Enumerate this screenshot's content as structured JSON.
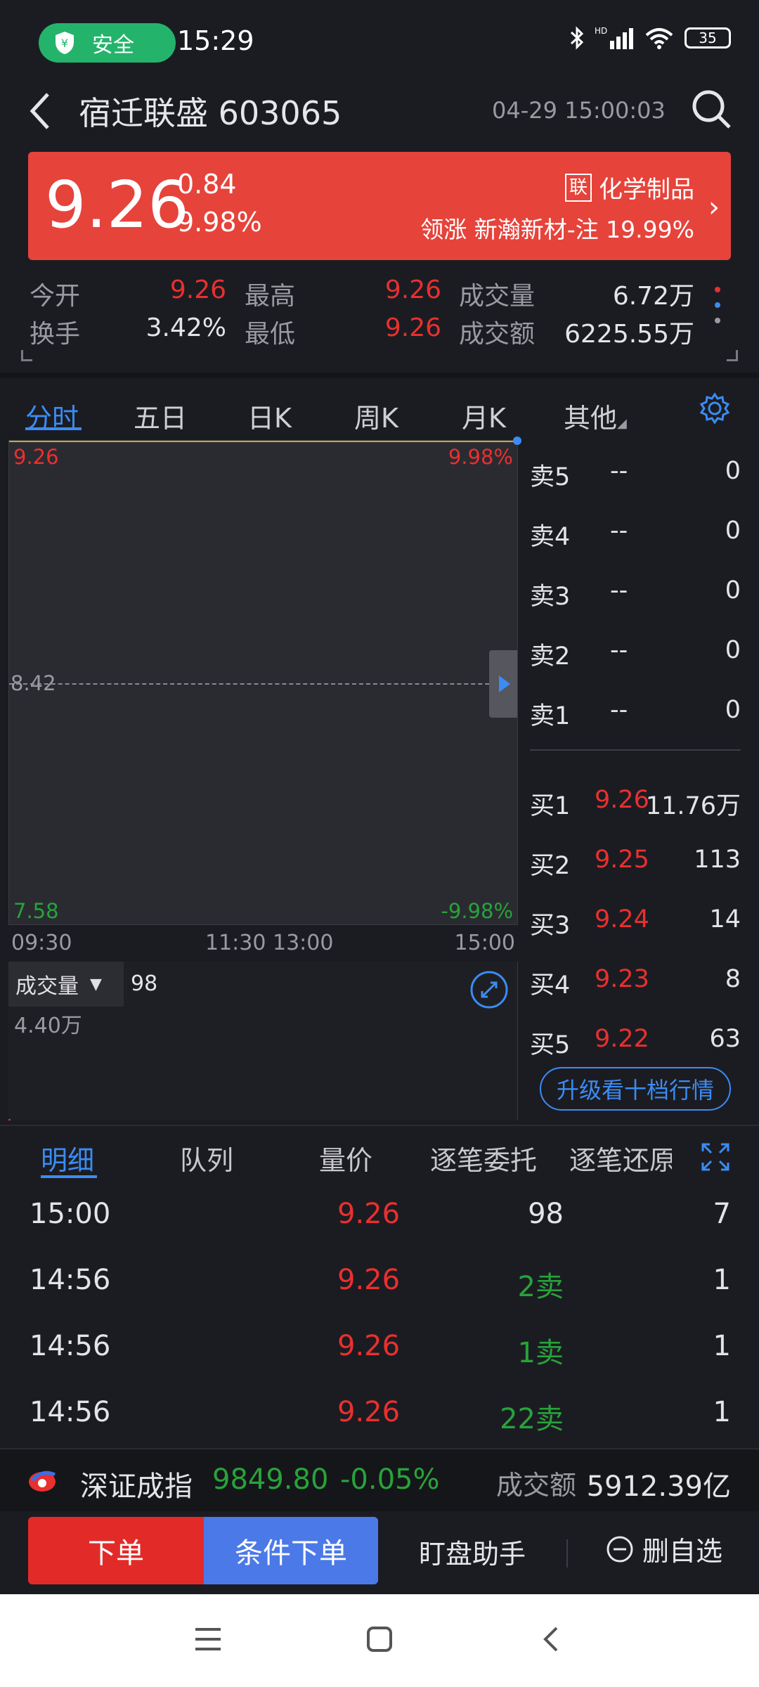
{
  "status": {
    "safe_label": "安全",
    "time": "15:29",
    "battery": "35",
    "hd": "HD"
  },
  "header": {
    "title": "宿迁联盛 603065",
    "timestamp": "04-29 15:00:03"
  },
  "quote": {
    "price": "9.26",
    "change": "0.84",
    "change_pct": "9.98%",
    "sector_tag": "联",
    "sector": "化学制品",
    "leader": "领涨 新瀚新材-注 19.99%"
  },
  "stats": {
    "open_label": "今开",
    "open": "9.26",
    "high_label": "最高",
    "high": "9.26",
    "volume_label": "成交量",
    "volume": "6.72万",
    "turnover_label": "换手",
    "turnover": "3.42%",
    "low_label": "最低",
    "low": "9.26",
    "amount_label": "成交额",
    "amount": "6225.55万"
  },
  "chart_tabs": [
    "分时",
    "五日",
    "日K",
    "周K",
    "月K",
    "其他"
  ],
  "chart": {
    "y_top": "9.26",
    "y_top_pct": "9.98%",
    "y_mid": "8.42",
    "y_bottom": "7.58",
    "y_bottom_pct": "-9.98%",
    "t0": "09:30",
    "t1": "11:30 13:00",
    "t2": "15:00",
    "vol_label": "成交量",
    "vol_value": "98",
    "vol_max": "4.40万"
  },
  "orderbook": {
    "asks": [
      {
        "label": "卖5",
        "price": "--",
        "qty": "0"
      },
      {
        "label": "卖4",
        "price": "--",
        "qty": "0"
      },
      {
        "label": "卖3",
        "price": "--",
        "qty": "0"
      },
      {
        "label": "卖2",
        "price": "--",
        "qty": "0"
      },
      {
        "label": "卖1",
        "price": "--",
        "qty": "0"
      }
    ],
    "bids": [
      {
        "label": "买1",
        "price": "9.26",
        "qty": "11.76万"
      },
      {
        "label": "买2",
        "price": "9.25",
        "qty": "113"
      },
      {
        "label": "买3",
        "price": "9.24",
        "qty": "14"
      },
      {
        "label": "买4",
        "price": "9.23",
        "qty": "8"
      },
      {
        "label": "买5",
        "price": "9.22",
        "qty": "63"
      }
    ],
    "upgrade": "升级看十档行情"
  },
  "detail_tabs": [
    "明细",
    "队列",
    "量价",
    "逐笔委托",
    "逐笔还原"
  ],
  "details": [
    {
      "time": "15:00",
      "price": "9.26",
      "vol": "98",
      "count": "7",
      "side": "neutral"
    },
    {
      "time": "14:56",
      "price": "9.26",
      "vol": "2卖",
      "count": "1",
      "side": "sell"
    },
    {
      "time": "14:56",
      "price": "9.26",
      "vol": "1卖",
      "count": "1",
      "side": "sell"
    },
    {
      "time": "14:56",
      "price": "9.26",
      "vol": "22卖",
      "count": "1",
      "side": "sell"
    }
  ],
  "index_bar": {
    "name": "深证成指",
    "value": "9849.80",
    "pct": "-0.05%",
    "amount_label": "成交额",
    "amount": "5912.39亿"
  },
  "actions": {
    "order": "下单",
    "cond_order": "条件下单",
    "helper": "盯盘助手",
    "remove": "删自选"
  },
  "colors": {
    "up": "#e8302f",
    "down": "#27a33a",
    "accent": "#3b8cf3",
    "banner": "#e6433b"
  }
}
